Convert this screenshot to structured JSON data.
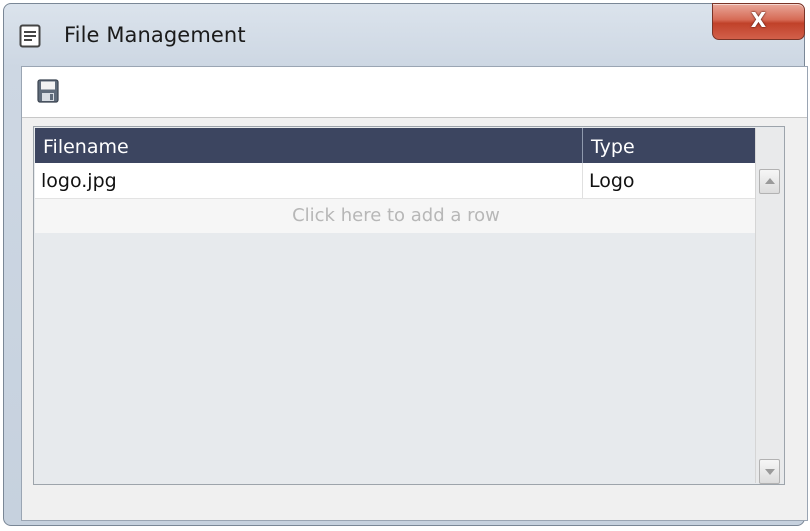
{
  "window": {
    "title": "File Management",
    "close_label": "X"
  },
  "toolbar": {
    "save_icon": "save-icon"
  },
  "grid": {
    "columns": [
      "Filename",
      "Type"
    ],
    "rows": [
      {
        "filename": "logo.jpg",
        "type": "Logo"
      }
    ],
    "add_row_text": "Click here to add a row"
  },
  "colors": {
    "header_bg": "#3c4560",
    "close_red": "#c0412a"
  }
}
